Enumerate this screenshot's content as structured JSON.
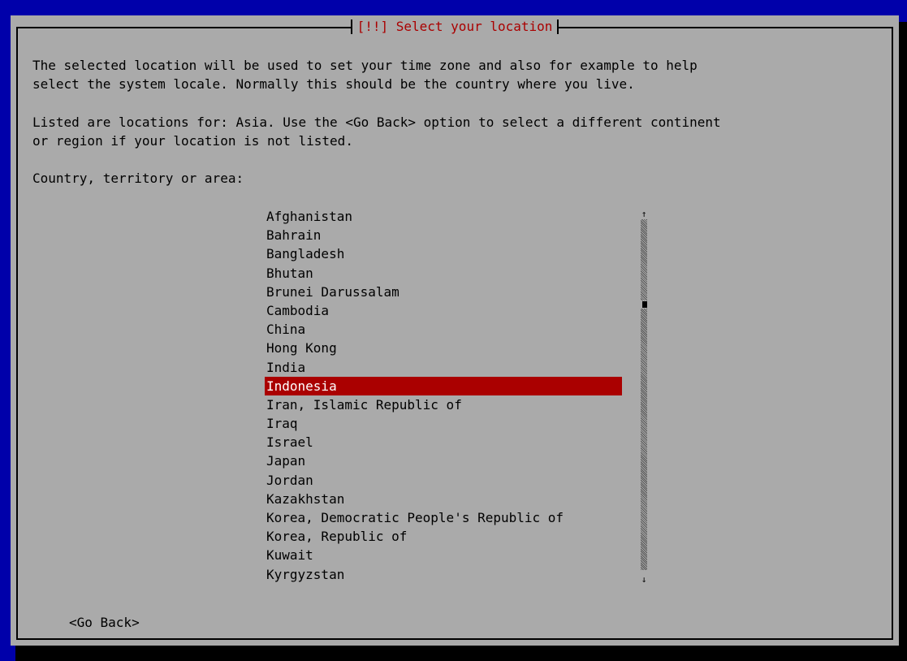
{
  "dialog": {
    "title": "[!!] Select your location",
    "para1": "The selected location will be used to set your time zone and also for example to help\nselect the system locale. Normally this should be the country where you live.",
    "para2": "Listed are locations for: Asia. Use the <Go Back> option to select a different continent\nor region if your location is not listed.",
    "prompt": "Country, territory or area:"
  },
  "country_list": {
    "items": [
      "Afghanistan",
      "Bahrain",
      "Bangladesh",
      "Bhutan",
      "Brunei Darussalam",
      "Cambodia",
      "China",
      "Hong Kong",
      "India",
      "Indonesia",
      "Iran, Islamic Republic of",
      "Iraq",
      "Israel",
      "Japan",
      "Jordan",
      "Kazakhstan",
      "Korea, Democratic People's Republic of",
      "Korea, Republic of",
      "Kuwait",
      "Kyrgyzstan"
    ],
    "selected": "Indonesia"
  },
  "scrollbar": {
    "up_icon": "arrow-up-icon",
    "down_icon": "arrow-down-icon",
    "up_glyph": "↑",
    "down_glyph": "↓"
  },
  "buttons": {
    "go_back": "<Go Back>"
  }
}
